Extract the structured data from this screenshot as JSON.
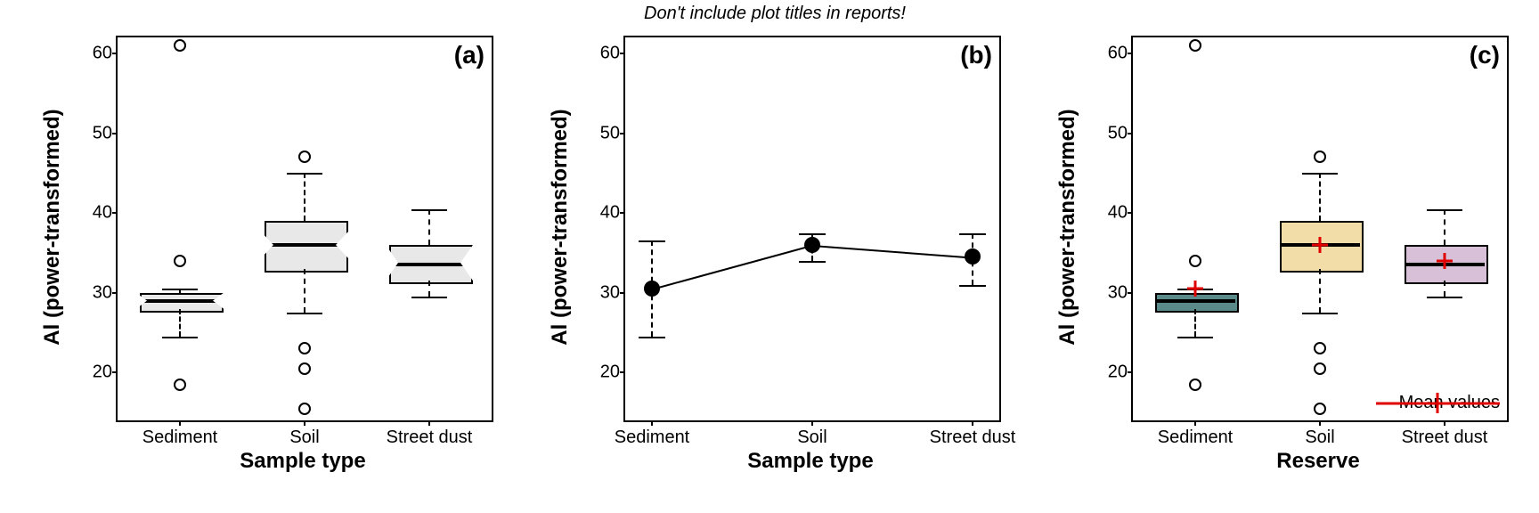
{
  "note": "Don't include plot titles in reports!",
  "panels": {
    "a": {
      "letter": "(a)",
      "ylabel": "Al (power-transformed)",
      "xlabel": "Sample type"
    },
    "b": {
      "letter": "(b)",
      "ylabel": "Al (power-transformed)",
      "xlabel": "Sample type"
    },
    "c": {
      "letter": "(c)",
      "ylabel": "Al (power-transformed)",
      "xlabel": "Reserve"
    }
  },
  "yticks": [
    "20",
    "30",
    "40",
    "50",
    "60"
  ],
  "xticks": [
    "Sediment",
    "Soil",
    "Street dust"
  ],
  "legend_c": "Mean values",
  "chart_data": [
    {
      "type": "boxplot",
      "panel": "a",
      "title": "(a)",
      "xlabel": "Sample type",
      "ylabel": "Al (power-transformed)",
      "ylim": [
        14,
        62
      ],
      "categories": [
        "Sediment",
        "Soil",
        "Street dust"
      ],
      "notched": true,
      "series": [
        {
          "name": "Sediment",
          "q1": 28,
          "median": 29,
          "q3": 30,
          "whisker_low": 24.5,
          "whisker_high": 30.5,
          "outliers": [
            18.5,
            34,
            61
          ]
        },
        {
          "name": "Soil",
          "q1": 33,
          "median": 36,
          "q3": 39,
          "whisker_low": 27.5,
          "whisker_high": 45,
          "outliers": [
            15.5,
            20.5,
            23,
            47
          ]
        },
        {
          "name": "Street dust",
          "q1": 31.5,
          "median": 33.5,
          "q3": 36,
          "whisker_low": 29.5,
          "whisker_high": 40.5,
          "outliers": []
        }
      ]
    },
    {
      "type": "line",
      "panel": "b",
      "title": "(b)",
      "xlabel": "Sample type",
      "ylabel": "Al (power-transformed)",
      "ylim": [
        14,
        62
      ],
      "categories": [
        "Sediment",
        "Soil",
        "Street dust"
      ],
      "series": [
        {
          "name": "mean",
          "values": [
            30.5,
            36,
            34.5
          ],
          "error_low": [
            24.5,
            34,
            31
          ],
          "error_high": [
            36.5,
            37.5,
            37.5
          ]
        }
      ]
    },
    {
      "type": "boxplot",
      "panel": "c",
      "title": "(c)",
      "xlabel": "Reserve",
      "ylabel": "Al (power-transformed)",
      "ylim": [
        14,
        62
      ],
      "categories": [
        "Sediment",
        "Soil",
        "Street dust"
      ],
      "notched": false,
      "colors": [
        "#5a8a8a",
        "#f2dca8",
        "#d9c0d9"
      ],
      "legend": "Mean values",
      "series": [
        {
          "name": "Sediment",
          "q1": 28,
          "median": 29,
          "q3": 30,
          "whisker_low": 24.5,
          "whisker_high": 30.5,
          "mean": 30.5,
          "outliers": [
            18.5,
            34,
            61
          ]
        },
        {
          "name": "Soil",
          "q1": 33,
          "median": 36,
          "q3": 39,
          "whisker_low": 27.5,
          "whisker_high": 45,
          "mean": 36,
          "outliers": [
            15.5,
            20.5,
            23,
            47
          ]
        },
        {
          "name": "Street dust",
          "q1": 31.5,
          "median": 33.5,
          "q3": 36,
          "whisker_low": 29.5,
          "whisker_high": 40.5,
          "mean": 34,
          "outliers": []
        }
      ]
    }
  ]
}
